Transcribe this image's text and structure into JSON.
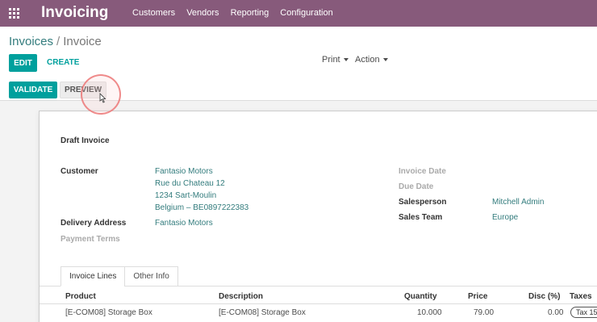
{
  "app": {
    "title": "Invoicing",
    "menu": [
      "Customers",
      "Vendors",
      "Reporting",
      "Configuration"
    ]
  },
  "breadcrumb": {
    "parent": "Invoices",
    "separator": "/",
    "current": "Invoice"
  },
  "toolbar": {
    "edit_label": "EDIT",
    "create_label": "CREATE",
    "print_label": "Print",
    "action_label": "Action"
  },
  "statusbar": {
    "validate_label": "VALIDATE",
    "preview_label": "PREVIEW"
  },
  "form": {
    "status_title": "Draft Invoice",
    "customer_label": "Customer",
    "customer_name": "Fantasio Motors",
    "customer_street": "Rue du Chateau 12",
    "customer_city": "1234 Sart-Moulin",
    "customer_country_vat": "Belgium – BE0897222383",
    "delivery_label": "Delivery Address",
    "delivery_value": "Fantasio Motors",
    "payment_terms_label": "Payment Terms",
    "invoice_date_label": "Invoice Date",
    "due_date_label": "Due Date",
    "salesperson_label": "Salesperson",
    "salesperson_value": "Mitchell Admin",
    "sales_team_label": "Sales Team",
    "sales_team_value": "Europe"
  },
  "tabs": {
    "invoice_lines": "Invoice Lines",
    "other_info": "Other Info"
  },
  "lines": {
    "headers": {
      "product": "Product",
      "description": "Description",
      "quantity": "Quantity",
      "price": "Price",
      "discount": "Disc (%)",
      "taxes": "Taxes"
    },
    "rows": [
      {
        "product": "[E-COM08] Storage Box",
        "description": "[E-COM08] Storage Box",
        "quantity": "10.000",
        "price": "79.00",
        "discount": "0.00",
        "taxes": "Tax 15"
      }
    ]
  },
  "colors": {
    "topbar": "#875a7b",
    "primary": "#00a09d",
    "link": "#337c7d"
  }
}
